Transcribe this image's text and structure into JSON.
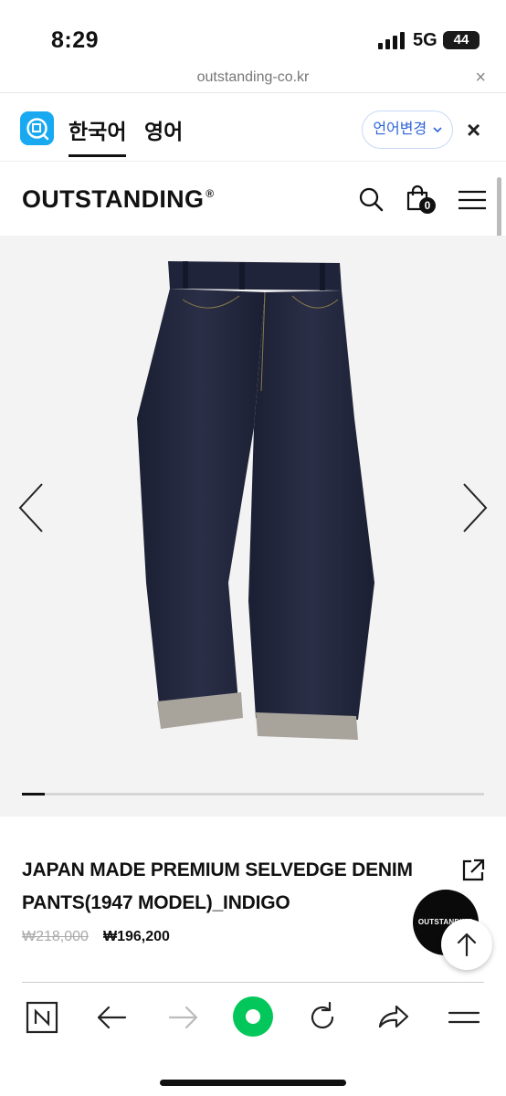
{
  "status": {
    "time": "8:29",
    "network": "5G",
    "battery": "44"
  },
  "browser": {
    "url": "outstanding-co.kr",
    "close_glyph": "×"
  },
  "translate_bar": {
    "lang_korean": "한국어",
    "lang_english": "영어",
    "change_label": "언어변경",
    "close_glyph": "×"
  },
  "site": {
    "logo": "OUTSTANDING",
    "logo_mark": "®",
    "cart_count": "0"
  },
  "gallery": {
    "slide_progress": 0.05
  },
  "product": {
    "title": "JAPAN MADE PREMIUM SELVEDGE DENIM PANTS(1947 MODEL)_INDIGO",
    "original_price": "₩218,000",
    "sale_price": "₩196,200",
    "badge_text": "OUTSTANDING"
  },
  "icons": {
    "header": [
      "search-icon",
      "shopping-bag-icon",
      "hamburger-menu-icon"
    ],
    "toolbar": [
      "naver-n-icon",
      "back-arrow-icon",
      "forward-arrow-icon",
      "green-dot-home-icon",
      "reload-icon",
      "share-icon",
      "menu-icon"
    ]
  },
  "colors": {
    "accent_blue": "#2d64d8",
    "papago_blue": "#18a9f0",
    "green": "#03c75a",
    "denim": "#22263a"
  }
}
